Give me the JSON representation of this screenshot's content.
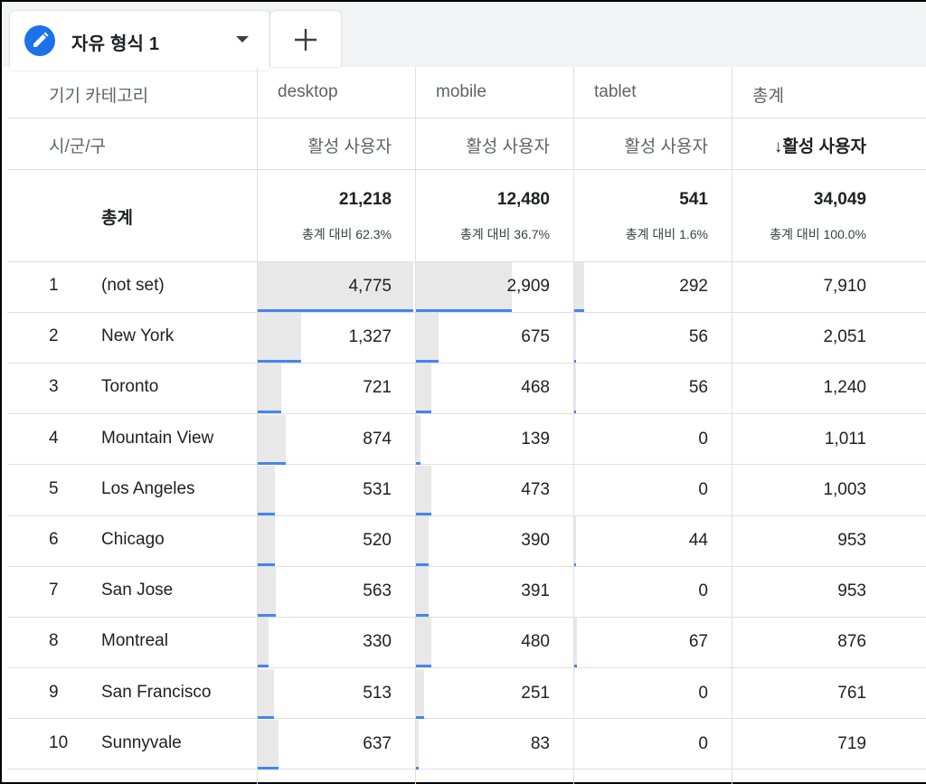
{
  "tab": {
    "title": "자유 형식 1"
  },
  "header": {
    "dimension_label": "기기 카테고리",
    "columns": [
      "desktop",
      "mobile",
      "tablet",
      "총계"
    ],
    "row_dimension_label": "시/군/구",
    "metric_labels": [
      "활성 사용자",
      "활성 사용자",
      "활성 사용자",
      "↓활성 사용자"
    ]
  },
  "totals": {
    "label": "총계",
    "values": [
      "21,218",
      "12,480",
      "541",
      "34,049"
    ],
    "shares": [
      "총계 대비 62.3%",
      "총계 대비 36.7%",
      "총계 대비 1.6%",
      "총계 대비 100.0%"
    ]
  },
  "rows": [
    {
      "rank": "1",
      "city": "(not set)",
      "desktop": "4,775",
      "mobile": "2,909",
      "tablet": "292",
      "total": "7,910"
    },
    {
      "rank": "2",
      "city": "New York",
      "desktop": "1,327",
      "mobile": "675",
      "tablet": "56",
      "total": "2,051"
    },
    {
      "rank": "3",
      "city": "Toronto",
      "desktop": "721",
      "mobile": "468",
      "tablet": "56",
      "total": "1,240"
    },
    {
      "rank": "4",
      "city": "Mountain View",
      "desktop": "874",
      "mobile": "139",
      "tablet": "0",
      "total": "1,011"
    },
    {
      "rank": "5",
      "city": "Los Angeles",
      "desktop": "531",
      "mobile": "473",
      "tablet": "0",
      "total": "1,003"
    },
    {
      "rank": "6",
      "city": "Chicago",
      "desktop": "520",
      "mobile": "390",
      "tablet": "44",
      "total": "953"
    },
    {
      "rank": "7",
      "city": "San Jose",
      "desktop": "563",
      "mobile": "391",
      "tablet": "0",
      "total": "953"
    },
    {
      "rank": "8",
      "city": "Montreal",
      "desktop": "330",
      "mobile": "480",
      "tablet": "67",
      "total": "876"
    },
    {
      "rank": "9",
      "city": "San Francisco",
      "desktop": "513",
      "mobile": "251",
      "tablet": "0",
      "total": "761"
    },
    {
      "rank": "10",
      "city": "Sunnyvale",
      "desktop": "637",
      "mobile": "83",
      "tablet": "0",
      "total": "719"
    }
  ],
  "colors": {
    "accent": "#1a73e8",
    "bar_fill": "#e8e8e8",
    "bar_line": "#4285f4"
  },
  "icons": {
    "tab_icon": "pencil-icon",
    "tab_menu": "caret-down-icon",
    "add_tab": "plus-icon"
  }
}
